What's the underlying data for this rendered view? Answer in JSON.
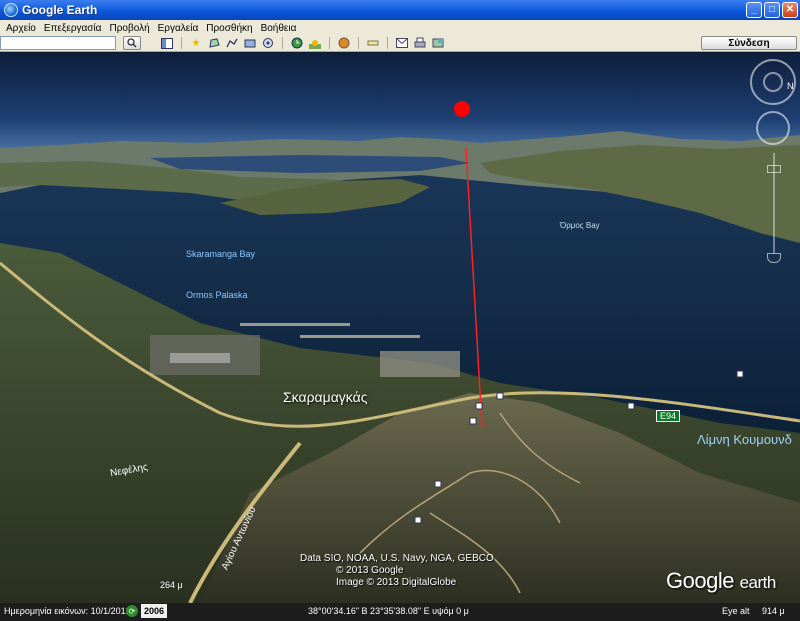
{
  "window": {
    "title": "Google Earth",
    "buttons": {
      "minimize": "_",
      "maximize": "□",
      "close": "✕"
    }
  },
  "menu": [
    "Αρχείο",
    "Επεξεργασία",
    "Προβολή",
    "Εργαλεία",
    "Προσθήκη",
    "Βοήθεια"
  ],
  "toolbar": {
    "search_value": "",
    "signin_label": "Σύνδεση",
    "icons": [
      "sidebar-icon",
      "placemark-icon",
      "polygon-icon",
      "path-icon",
      "overlay-icon",
      "tour-icon",
      "historical-imagery-icon",
      "sunlight-icon",
      "planets-icon",
      "ruler-icon",
      "email-icon",
      "print-icon",
      "maps-icon"
    ]
  },
  "map": {
    "labels": {
      "place_main": "Σκαραμαγκάς",
      "bay_skaramanga": "Skaramanga Bay",
      "ormos": "Ormos Palaska",
      "bay_right": "Όρμος Bay",
      "lake": "Λίμνη Κουμουνδ",
      "street_1": "Νεφέλης",
      "street_2": "Αγίου Αντωνίου",
      "road": "E94"
    },
    "credits": [
      "Data SIO, NOAA, U.S. Navy, NGA, GEBCO",
      "© 2013 Google",
      "Image © 2013 DigitalGlobe"
    ],
    "brand": {
      "google": "Google",
      "earth": "earth"
    },
    "scale": "264 μ",
    "colors": {
      "marker": "#ff0000",
      "sea": "#0f2744",
      "land": "#3d4a2a"
    }
  },
  "status": {
    "imagery_date": "Ημερομηνία εικόνων: 10/1/2012",
    "history_btn": "⟳",
    "year": "2006",
    "coords": "38°00'34.16\" B  23°35'38.08\" E  υψόμ  0 μ",
    "eye_alt_label": "Eye alt",
    "eye_alt_value": "914 μ"
  }
}
